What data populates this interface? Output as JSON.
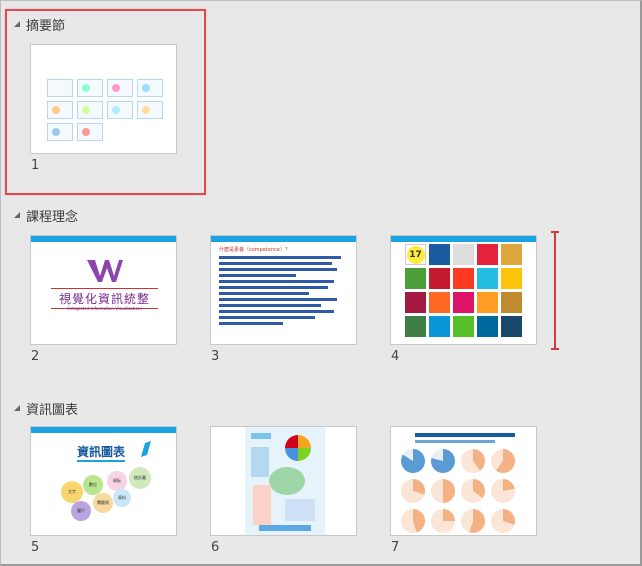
{
  "sections": [
    {
      "title": "摘要節"
    },
    {
      "title": "課程理念"
    },
    {
      "title": "資訊圖表"
    }
  ],
  "slides": [
    {
      "number": "1"
    },
    {
      "number": "2",
      "title": "視覺化資訊統整",
      "subtitle": "(Integrated Information Visualization)"
    },
    {
      "number": "3",
      "heading": "什麼是素養（competence）？"
    },
    {
      "number": "4",
      "sdg_count": "17"
    },
    {
      "number": "5",
      "title": "資訊圖表",
      "bubbles": [
        "文字",
        "數位",
        "模板",
        "統計圖",
        "資料",
        "圖片",
        "關鍵詞"
      ]
    },
    {
      "number": "6"
    },
    {
      "number": "7"
    }
  ],
  "colors": {
    "selection": "#e04b4b",
    "accent": "#1aa3e0"
  }
}
